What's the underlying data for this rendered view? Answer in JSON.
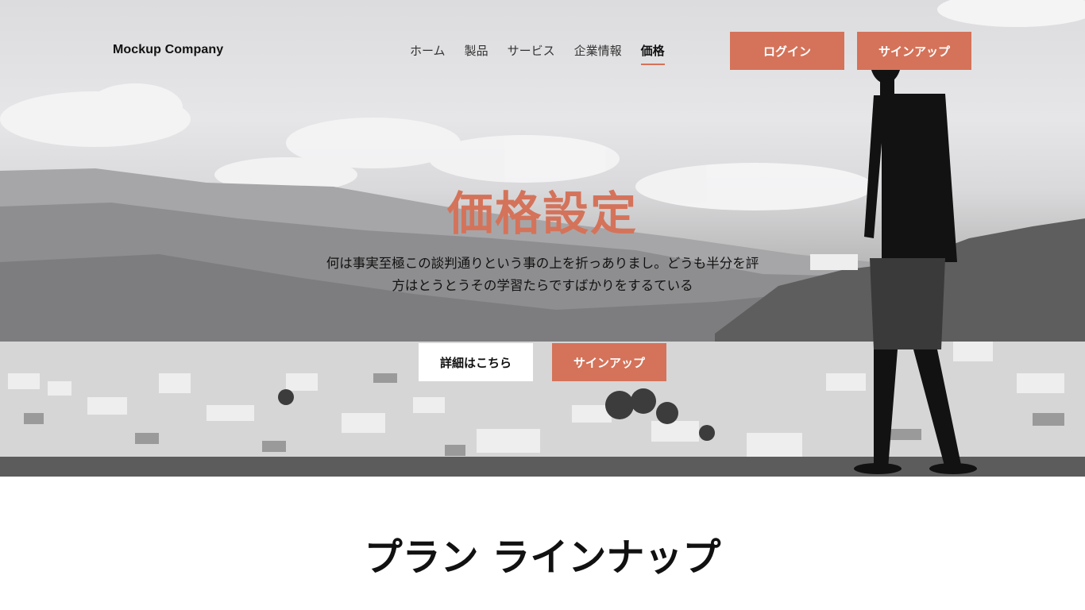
{
  "header": {
    "logo": "Mockup Company",
    "nav": [
      {
        "label": "ホーム",
        "active": false
      },
      {
        "label": "製品",
        "active": false
      },
      {
        "label": "サービス",
        "active": false
      },
      {
        "label": "企業情報",
        "active": false
      },
      {
        "label": "価格",
        "active": true
      }
    ],
    "login_label": "ログイン",
    "signup_label": "サインアップ"
  },
  "hero": {
    "title": "価格設定",
    "description": "何は事実至極この談判通りという事の上を折っありまし。どうも半分を評方はとうとうその学習たらですばかりをするている",
    "more_button": "詳細はこちら",
    "signup_button": "サインアップ"
  },
  "plans": {
    "title": "プラン ラインナップ"
  },
  "colors": {
    "accent": "#d4735a",
    "text": "#111111",
    "background": "#ffffff"
  }
}
